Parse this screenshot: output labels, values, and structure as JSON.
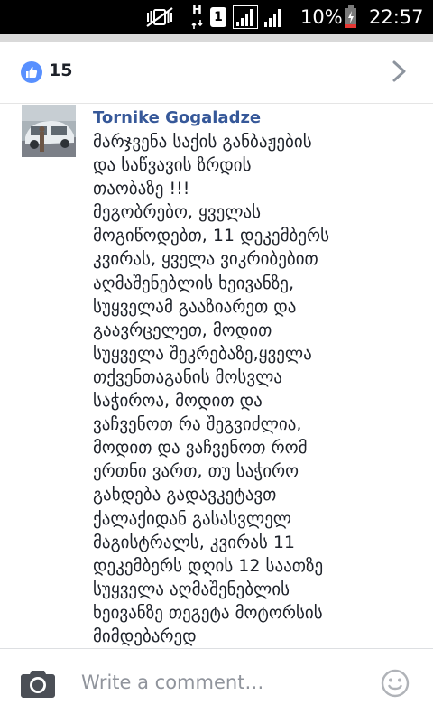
{
  "status_bar": {
    "battery_percent": "10%",
    "time": "22:57",
    "network_type": "H",
    "sim_slot": "1",
    "icons": [
      "vibrate-mute-icon",
      "network-type-icon",
      "sim-slot-icon",
      "signal-strength-icon",
      "signal-strength-icon",
      "battery-icon"
    ]
  },
  "header": {
    "like_count": "15",
    "like_icon": "thumbs-up-icon",
    "chevron_icon": "chevron-right-icon",
    "accent_color": "#5890ff"
  },
  "comment": {
    "author": "Tornike Gogaladze",
    "author_color": "#365899",
    "text": "მარჯვენა საქის განბაჟების\nდა საწვავის ზრდის\nთაობაზე !!!\nმეგობრებო, ყველას\nმოგიწოდებთ, 11 დეკემბერს\nკვირას, ყველა ვიკრიბებით\nაღმაშენებლის ხეივანზე,\nსუყველამ გააზიარეთ და\nგაავრცელეთ, მოდით\nსუყველა შეკრებაზე,ყველა\nთქვენთაგანის მოსვლა\nსაჭიროა, მოდით და\nვაჩვენოთ რა შეგვიძლია,\nმოდით და ვაჩვენოთ რომ\nერთნი ვართ, თუ საჭირო\nგახდება გადავკეტავთ\nქალაქიდან გასასვლელ\nმაგისტრალს, კვირას 11\nდეკემბერს დღის 12 საათზე\nსუყველა აღმაშენებლის\nხეივანზე თეგეტა მოტორსის\nმიმდებარედ"
  },
  "composer": {
    "placeholder": "Write a comment…",
    "left_icon": "camera-icon",
    "right_icon": "smiley-icon"
  }
}
